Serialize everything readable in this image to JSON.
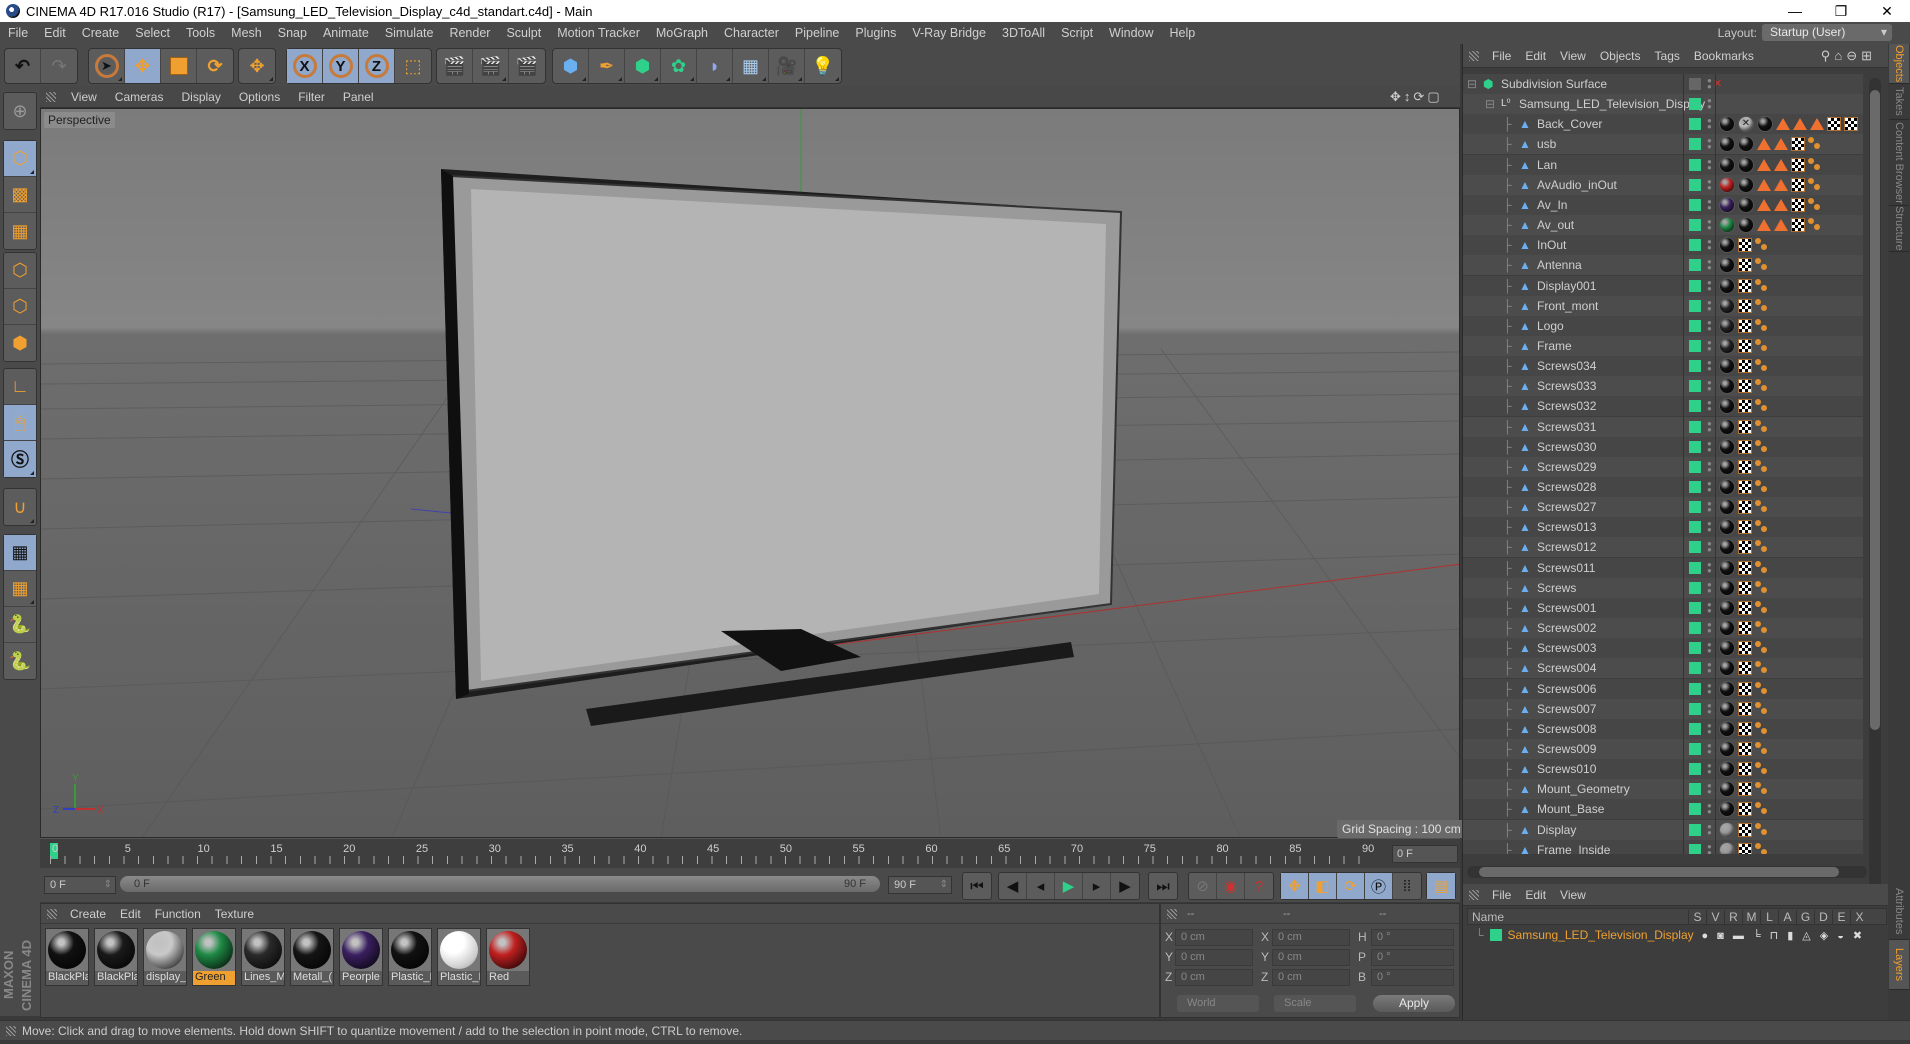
{
  "window": {
    "title": "CINEMA 4D R17.016 Studio (R17) - [Samsung_LED_Television_Display_c4d_standart.c4d] - Main",
    "controls": [
      "minimize",
      "restore",
      "close"
    ]
  },
  "menubar": {
    "items": [
      "File",
      "Edit",
      "Create",
      "Select",
      "Tools",
      "Mesh",
      "Snap",
      "Animate",
      "Simulate",
      "Render",
      "Sculpt",
      "Motion Tracker",
      "MoGraph",
      "Character",
      "Pipeline",
      "Plugins",
      "V-Ray Bridge",
      "3DToAll",
      "Script",
      "Window",
      "Help"
    ],
    "layout_label": "Layout:",
    "layout_value": "Startup (User)"
  },
  "toolbar": {
    "undo": "undo-icon",
    "redo": "redo-icon",
    "tools": [
      "select-tool",
      "move-tool",
      "scale-tool",
      "rotate-tool",
      "transform-tool"
    ],
    "axes": [
      "X",
      "Y",
      "Z"
    ],
    "coord_system": "world-coord-icon",
    "render": [
      "render-view",
      "render-picture-viewer",
      "render-settings"
    ],
    "create": [
      "cube-primitive",
      "pen-spline",
      "subdivision-generator",
      "cloner",
      "deformer-bend",
      "floor-environment",
      "camera",
      "light"
    ]
  },
  "left_toolbar": {
    "modes": [
      "make-editable",
      "model-mode",
      "texture-mode",
      "workplane-mode",
      "points-mode",
      "edges-mode",
      "polygons-mode",
      "enable-axis",
      "tweak-mode",
      "solo-mode",
      "snap",
      "workplane-lock",
      "workplane-align",
      "python-1",
      "python-2"
    ]
  },
  "viewport": {
    "menu": [
      "View",
      "Cameras",
      "Display",
      "Options",
      "Filter",
      "Panel"
    ],
    "label": "Perspective",
    "grid_spacing": "Grid Spacing : 100 cm",
    "axis_labels": {
      "x": "X",
      "y": "Y",
      "z": "Z"
    }
  },
  "timeline": {
    "ticks": [
      "0",
      "5",
      "10",
      "15",
      "20",
      "25",
      "30",
      "35",
      "40",
      "45",
      "50",
      "55",
      "60",
      "65",
      "70",
      "75",
      "80",
      "85",
      "90"
    ],
    "current_frame": "0 F",
    "start_field": "0 F",
    "slider_label": "0 F",
    "slider_end": "90 F",
    "end_field": "90 F",
    "current_right": "0 F"
  },
  "materials": {
    "menu": [
      "Create",
      "Edit",
      "Function",
      "Texture"
    ],
    "items": [
      {
        "label": "BlackPla",
        "color": "#111111"
      },
      {
        "label": "BlackPla",
        "color": "#1a1a1a"
      },
      {
        "label": "display_",
        "color": "#c8c8c8"
      },
      {
        "label": "Green",
        "color": "#1f8a45",
        "selected": true
      },
      {
        "label": "Lines_M",
        "color": "#2a2a2a"
      },
      {
        "label": "Metall_(",
        "color": "#151515"
      },
      {
        "label": "Peorple",
        "color": "#3a2060"
      },
      {
        "label": "Plastic_N",
        "color": "#111111"
      },
      {
        "label": "Plastic_F",
        "color": "#eeeeee"
      },
      {
        "label": "Red",
        "color": "#c02020"
      }
    ]
  },
  "brand": "MAXON CINEMA 4D",
  "coordinates": {
    "headers": [
      "--",
      "--",
      "--"
    ],
    "position": {
      "X": "0 cm",
      "Y": "0 cm",
      "Z": "0 cm"
    },
    "size": {
      "X": "0 cm",
      "Y": "0 cm",
      "Z": "0 cm"
    },
    "rotation": {
      "H": "0 °",
      "P": "0 °",
      "B": "0 °"
    },
    "mode1": "World",
    "mode2": "Scale",
    "apply": "Apply"
  },
  "object_manager": {
    "menu": [
      "File",
      "Edit",
      "View",
      "Objects",
      "Tags",
      "Bookmarks"
    ],
    "objects": [
      {
        "name": "Subdivision Surface",
        "type": "subdivision",
        "level": 0,
        "tags": []
      },
      {
        "name": "Samsung_LED_Television_Display",
        "type": "null",
        "level": 1,
        "tags": []
      },
      {
        "name": "Back_Cover",
        "type": "polygon",
        "level": 2,
        "tags": [
          "ball:#111",
          "ball-x:#bbb",
          "ball:#111",
          "tri",
          "tri",
          "tri",
          "chk",
          "chk"
        ]
      },
      {
        "name": "usb",
        "type": "polygon",
        "level": 2,
        "tags": [
          "ball:#111",
          "ball:#111",
          "tri",
          "tri",
          "chk",
          "uvw"
        ]
      },
      {
        "name": "Lan",
        "type": "polygon",
        "level": 2,
        "tags": [
          "ball:#111",
          "ball:#111",
          "tri",
          "tri",
          "chk",
          "uvw"
        ]
      },
      {
        "name": "AvAudio_inOut",
        "type": "polygon",
        "level": 2,
        "tags": [
          "ball:#c02020",
          "ball:#111",
          "tri",
          "tri",
          "chk",
          "uvw"
        ]
      },
      {
        "name": "Av_In",
        "type": "polygon",
        "level": 2,
        "tags": [
          "ball:#3a2060",
          "ball:#111",
          "tri",
          "tri",
          "chk",
          "uvw"
        ]
      },
      {
        "name": "Av_out",
        "type": "polygon",
        "level": 2,
        "tags": [
          "ball:#1f8a45",
          "ball:#111",
          "tri",
          "tri",
          "chk",
          "uvw"
        ]
      },
      {
        "name": "InOut",
        "type": "polygon",
        "level": 2,
        "tags": [
          "ball:#111",
          "chk",
          "uvw"
        ]
      },
      {
        "name": "Antenna",
        "type": "polygon",
        "level": 2,
        "tags": [
          "ball:#111",
          "chk",
          "uvw"
        ]
      },
      {
        "name": "Display001",
        "type": "polygon",
        "level": 2,
        "tags": [
          "ball:#111",
          "chk",
          "uvw"
        ]
      },
      {
        "name": "Front_mont",
        "type": "polygon",
        "level": 2,
        "tags": [
          "ball:#222",
          "chk",
          "uvw"
        ]
      },
      {
        "name": "Logo",
        "type": "polygon",
        "level": 2,
        "tags": [
          "ball:#222",
          "chk",
          "uvw"
        ]
      },
      {
        "name": "Frame",
        "type": "polygon",
        "level": 2,
        "tags": [
          "ball:#222",
          "chk",
          "uvw"
        ]
      },
      {
        "name": "Screws034",
        "type": "polygon",
        "level": 2,
        "tags": [
          "ball:#111",
          "chk",
          "uvw"
        ]
      },
      {
        "name": "Screws033",
        "type": "polygon",
        "level": 2,
        "tags": [
          "ball:#111",
          "chk",
          "uvw"
        ]
      },
      {
        "name": "Screws032",
        "type": "polygon",
        "level": 2,
        "tags": [
          "ball:#111",
          "chk",
          "uvw"
        ]
      },
      {
        "name": "Screws031",
        "type": "polygon",
        "level": 2,
        "tags": [
          "ball:#111",
          "chk",
          "uvw"
        ]
      },
      {
        "name": "Screws030",
        "type": "polygon",
        "level": 2,
        "tags": [
          "ball:#111",
          "chk",
          "uvw"
        ]
      },
      {
        "name": "Screws029",
        "type": "polygon",
        "level": 2,
        "tags": [
          "ball:#111",
          "chk",
          "uvw"
        ]
      },
      {
        "name": "Screws028",
        "type": "polygon",
        "level": 2,
        "tags": [
          "ball:#111",
          "chk",
          "uvw"
        ]
      },
      {
        "name": "Screws027",
        "type": "polygon",
        "level": 2,
        "tags": [
          "ball:#111",
          "chk",
          "uvw"
        ]
      },
      {
        "name": "Screws013",
        "type": "polygon",
        "level": 2,
        "tags": [
          "ball:#111",
          "chk",
          "uvw"
        ]
      },
      {
        "name": "Screws012",
        "type": "polygon",
        "level": 2,
        "tags": [
          "ball:#111",
          "chk",
          "uvw"
        ]
      },
      {
        "name": "Screws011",
        "type": "polygon",
        "level": 2,
        "tags": [
          "ball:#111",
          "chk",
          "uvw"
        ]
      },
      {
        "name": "Screws",
        "type": "polygon",
        "level": 2,
        "tags": [
          "ball:#111",
          "chk",
          "uvw"
        ]
      },
      {
        "name": "Screws001",
        "type": "polygon",
        "level": 2,
        "tags": [
          "ball:#111",
          "chk",
          "uvw"
        ]
      },
      {
        "name": "Screws002",
        "type": "polygon",
        "level": 2,
        "tags": [
          "ball:#111",
          "chk",
          "uvw"
        ]
      },
      {
        "name": "Screws003",
        "type": "polygon",
        "level": 2,
        "tags": [
          "ball:#111",
          "chk",
          "uvw"
        ]
      },
      {
        "name": "Screws004",
        "type": "polygon",
        "level": 2,
        "tags": [
          "ball:#111",
          "chk",
          "uvw"
        ]
      },
      {
        "name": "Screws006",
        "type": "polygon",
        "level": 2,
        "tags": [
          "ball:#111",
          "chk",
          "uvw"
        ]
      },
      {
        "name": "Screws007",
        "type": "polygon",
        "level": 2,
        "tags": [
          "ball:#111",
          "chk",
          "uvw"
        ]
      },
      {
        "name": "Screws008",
        "type": "polygon",
        "level": 2,
        "tags": [
          "ball:#111",
          "chk",
          "uvw"
        ]
      },
      {
        "name": "Screws009",
        "type": "polygon",
        "level": 2,
        "tags": [
          "ball:#111",
          "chk",
          "uvw"
        ]
      },
      {
        "name": "Screws010",
        "type": "polygon",
        "level": 2,
        "tags": [
          "ball:#111",
          "chk",
          "uvw"
        ]
      },
      {
        "name": "Mount_Geometry",
        "type": "polygon",
        "level": 2,
        "tags": [
          "ball:#111",
          "chk",
          "uvw"
        ]
      },
      {
        "name": "Mount_Base",
        "type": "polygon",
        "level": 2,
        "tags": [
          "ball:#111",
          "chk",
          "uvw"
        ]
      },
      {
        "name": "Display",
        "type": "polygon",
        "level": 2,
        "tags": [
          "ball:#999",
          "chk",
          "uvw"
        ]
      },
      {
        "name": "Frame_Inside",
        "type": "polygon",
        "level": 2,
        "tags": [
          "ball:#999",
          "chk",
          "uvw"
        ]
      }
    ]
  },
  "side_tabs": {
    "top": [
      {
        "label": "Objects",
        "active": true
      },
      {
        "label": "Takes"
      },
      {
        "label": "Content Browser"
      },
      {
        "label": "Structure"
      }
    ],
    "bottom": [
      {
        "label": "Attributes"
      },
      {
        "label": "Layers",
        "active": true
      }
    ]
  },
  "layer_manager": {
    "menu": [
      "File",
      "Edit",
      "View"
    ],
    "columns": [
      "Name",
      "S",
      "V",
      "R",
      "M",
      "L",
      "A",
      "G",
      "D",
      "E",
      "X"
    ],
    "layers": [
      {
        "name": "Samsung_LED_Television_Display",
        "color": "#2fd08a"
      }
    ]
  },
  "status": "Move: Click and drag to move elements. Hold down SHIFT to quantize movement / add to the selection in point mode, CTRL to remove.",
  "colors": {
    "accent": "#f0a030",
    "selection": "#8fa8cc",
    "layer": "#2fd08a"
  }
}
